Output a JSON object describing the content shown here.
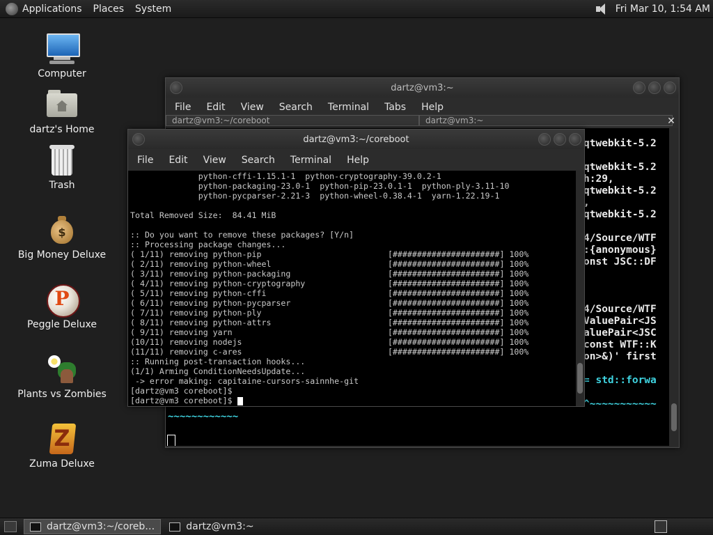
{
  "top_panel": {
    "menus": [
      "Applications",
      "Places",
      "System"
    ],
    "clock": "Fri Mar 10,  1:54 AM"
  },
  "desktop": {
    "icons": [
      {
        "label": "Computer",
        "icon": "computer-icon"
      },
      {
        "label": "dartz's Home",
        "icon": "home-folder-icon"
      },
      {
        "label": "Trash",
        "icon": "trash-icon"
      },
      {
        "label": "Big Money Deluxe",
        "icon": "money-bag-icon"
      },
      {
        "label": "Peggle Deluxe",
        "icon": "peggle-icon"
      },
      {
        "label": "Plants vs Zombies",
        "icon": "plants-vs-zombies-icon"
      },
      {
        "label": "Zuma Deluxe",
        "icon": "zuma-icon"
      }
    ]
  },
  "back_window": {
    "title": "dartz@vm3:~",
    "menus": [
      "File",
      "Edit",
      "View",
      "Search",
      "Terminal",
      "Tabs",
      "Help"
    ],
    "tabs": [
      "dartz@vm3:~/coreboot",
      "dartz@vm3:~"
    ],
    "visible_lines": [
      "qtwebkit-5.2",
      "",
      "qtwebkit-5.2",
      "h:29,",
      "qtwebkit-5.2",
      ",",
      "qtwebkit-5.2",
      "",
      "4/Source/WTF",
      ":{anonymous}",
      "onst JSC::DF",
      "",
      "",
      "",
      "4/Source/WTF",
      "ValuePair<JS",
      "aluePair<JSC",
      "const WTF::K",
      "on>&)' first",
      "",
      "= std::forwa",
      "",
      "^~~~~~~~~~~~"
    ],
    "bottom_line": "~~~~~~~~~~~~"
  },
  "front_window": {
    "title": "dartz@vm3:~/coreboot",
    "menus": [
      "File",
      "Edit",
      "View",
      "Search",
      "Terminal",
      "Help"
    ],
    "lines": [
      "              python-cffi-1.15.1-1  python-cryptography-39.0.2-1",
      "              python-packaging-23.0-1  python-pip-23.0.1-1  python-ply-3.11-10",
      "              python-pycparser-2.21-3  python-wheel-0.38.4-1  yarn-1.22.19-1",
      "",
      "Total Removed Size:  84.41 MiB",
      "",
      ":: Do you want to remove these packages? [Y/n]",
      ":: Processing package changes...",
      "( 1/11) removing python-pip                          [######################] 100%",
      "( 2/11) removing python-wheel                        [######################] 100%",
      "( 3/11) removing python-packaging                    [######################] 100%",
      "( 4/11) removing python-cryptography                 [######################] 100%",
      "( 5/11) removing python-cffi                         [######################] 100%",
      "( 6/11) removing python-pycparser                    [######################] 100%",
      "( 7/11) removing python-ply                          [######################] 100%",
      "( 8/11) removing python-attrs                        [######################] 100%",
      "( 9/11) removing yarn                                [######################] 100%",
      "(10/11) removing nodejs                              [######################] 100%",
      "(11/11) removing c-ares                              [######################] 100%",
      ":: Running post-transaction hooks...",
      "(1/1) Arming ConditionNeedsUpdate...",
      " -> error making: capitaine-cursors-sainnhe-git",
      "[dartz@vm3 coreboot]$",
      "[dartz@vm3 coreboot]$ "
    ]
  },
  "taskbar": {
    "tasks": [
      {
        "label": "dartz@vm3:~/coreb…",
        "active": true
      },
      {
        "label": "dartz@vm3:~",
        "active": false
      }
    ]
  },
  "colors": {
    "terminal_bg": "#000000",
    "terminal_fg": "#c9c9c9",
    "cyan_text": "#3fd3e0",
    "panel_bg": "#1f1f1f"
  }
}
